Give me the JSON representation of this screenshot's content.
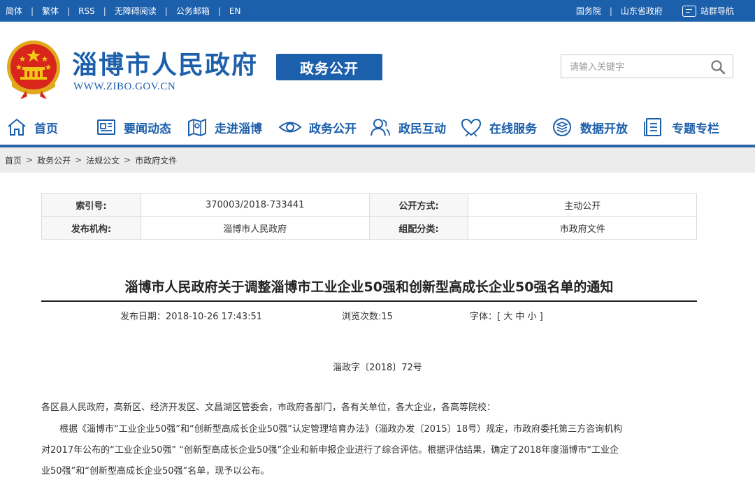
{
  "topbar": {
    "left_links": [
      "简体",
      "繁体",
      "RSS",
      "无障碍阅读",
      "公务邮箱",
      "EN"
    ],
    "right_links": [
      "国务院",
      "山东省政府"
    ],
    "sitemap_label": "站群导航"
  },
  "header": {
    "site_name": "淄博市人民政府",
    "site_url": "WWW.ZIBO.GOV.CN",
    "section_badge": "政务公开",
    "search_placeholder": "请输入关键字"
  },
  "nav": {
    "items": [
      {
        "label": "首页",
        "icon": "home-icon"
      },
      {
        "label": "要闻动态",
        "icon": "news-icon"
      },
      {
        "label": "走进淄博",
        "icon": "map-icon"
      },
      {
        "label": "政务公开",
        "icon": "eye-icon"
      },
      {
        "label": "政民互动",
        "icon": "people-icon"
      },
      {
        "label": "在线服务",
        "icon": "heart-icon"
      },
      {
        "label": "数据开放",
        "icon": "layers-icon"
      },
      {
        "label": "专题专栏",
        "icon": "document-icon"
      }
    ]
  },
  "breadcrumb": [
    "首页",
    "政务公开",
    "法规公文",
    "市政府文件"
  ],
  "meta": {
    "index_label": "索引号:",
    "index_value": "370003/2018-733441",
    "open_label": "公开方式:",
    "open_value": "主动公开",
    "issuer_label": "发布机构:",
    "issuer_value": "淄博市人民政府",
    "category_label": "组配分类:",
    "category_value": "市政府文件"
  },
  "article": {
    "title": "淄博市人民政府关于调整淄博市工业企业50强和创新型高成长企业50强名单的通知",
    "publish_date": "发布日期：2018-10-26 17:43:51",
    "views": "浏览次数:15",
    "font_size_label": "字体：[ 大 中 小 ]",
    "doc_number": "淄政字〔2018〕72号",
    "addressee": "各区县人民政府，高新区、经济开发区、文昌湖区管委会，市政府各部门，各有关单位，各大企业，各高等院校：",
    "body_line1": "根据《淄博市“工业企业50强”和“创新型高成长企业50强”认定管理培育办法》（淄政办发〔2015〕18号）规定，市政府委托第三方咨询机构",
    "body_line2": "对2017年公布的“工业企业50强” “创新型高成长企业50强”企业和新申报企业进行了综合评估。根据评估结果，确定了2018年度淄博市“工业企",
    "body_line3": "业50强”和“创新型高成长企业50强”名单，现予以公布。"
  },
  "colors": {
    "brand_blue": "#1c5fab",
    "emblem_red": "#d8261c",
    "emblem_gold": "#f5c518"
  }
}
